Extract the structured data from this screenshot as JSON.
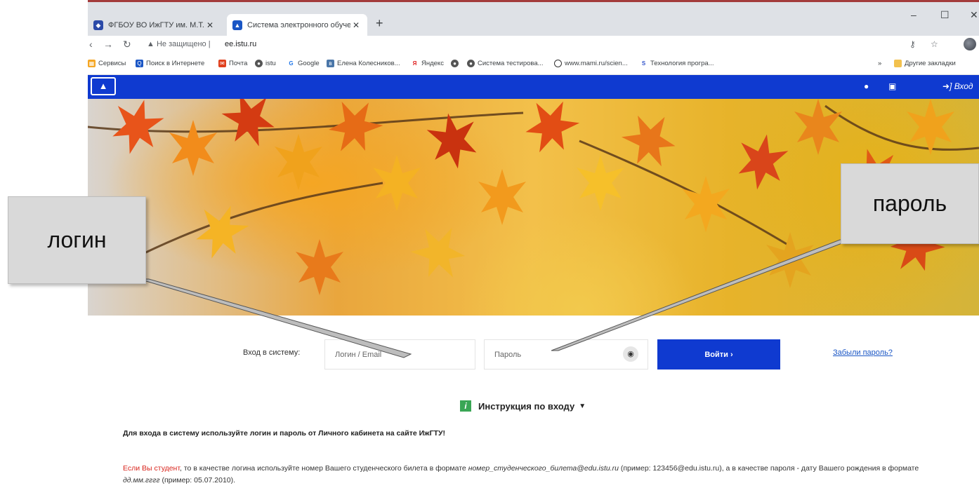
{
  "browser": {
    "tabs": [
      {
        "title": "ФГБОУ ВО ИжГТУ им. М.Т. Калашникова",
        "active": false
      },
      {
        "title": "Система электронного обучения",
        "active": true
      }
    ],
    "newtab": "+",
    "tab_close": "✕",
    "window": {
      "minimize": "–",
      "maximize": "☐",
      "close": "✕"
    },
    "security_label": "Не защищено",
    "url": "ee.istu.ru",
    "bookmarks": [
      "Сервисы",
      "Поиск в Интернете",
      "Почта",
      "istu",
      "Google",
      "Елена Колесников...",
      "Яндекс",
      "",
      "Система тестирова...",
      "www.mami.ru/scien...",
      "Технология програ..."
    ],
    "bookmarks_more": "»",
    "other_bookmarks": "Другие закладки"
  },
  "site_nav": {
    "login_label": "Вход"
  },
  "login_form": {
    "label": "Вход в систему:",
    "login_placeholder": "Логин / Email",
    "password_placeholder": "Пароль",
    "submit_label": "Войти  ›",
    "forgot_label": "Забыли пароль?"
  },
  "instructions": {
    "title": "Инструкция по входу",
    "icon_letter": "i",
    "para1": "Для входа в систему используйте логин и пароль от Личного кабинета на сайте ИжГТУ!",
    "para2_red": "Если Вы студент",
    "para2_a": ", то в качестве логина используйте номер Вашего студенческого билета в формате ",
    "para2_em1": "номер_студенческого_билета@edu.istu.ru",
    "para2_b": " (пример: 123456@edu.istu.ru), а в качестве пароля - дату Вашего рождения в формате ",
    "para2_em2": "дд.мм.гггг",
    "para2_c": " (пример: 05.07.2010)."
  },
  "callouts": {
    "login": "логин",
    "password": "пароль"
  },
  "colors": {
    "navbar": "#0f3ad0",
    "link": "#1a56c5",
    "accent_red": "#d9251d"
  }
}
